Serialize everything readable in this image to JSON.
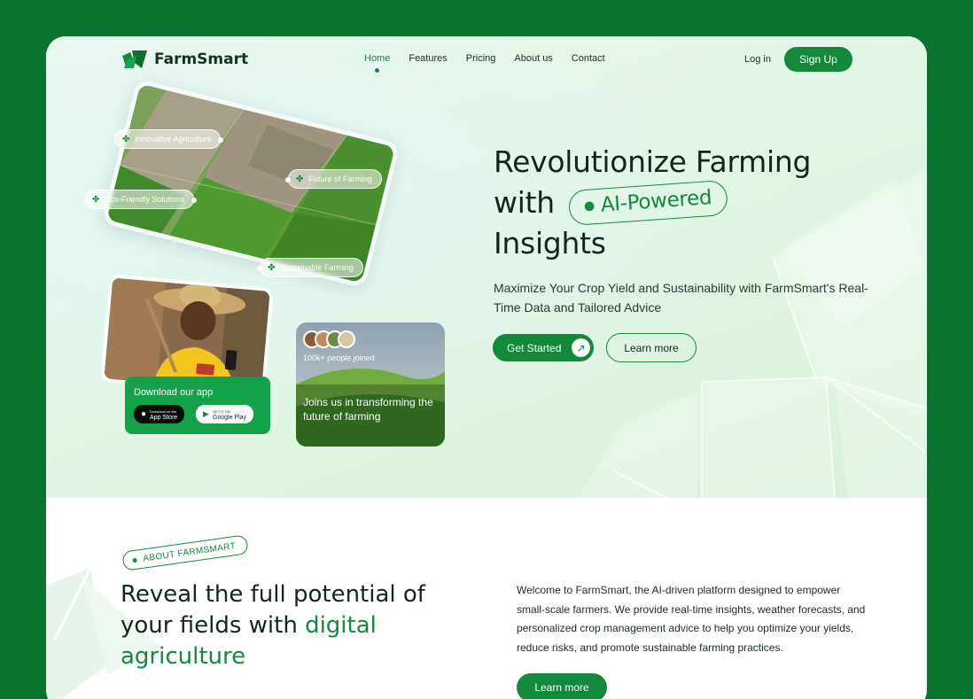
{
  "brand": {
    "name": "FarmSmart",
    "color": "#128a3a",
    "outer_bg": "#0b7331"
  },
  "nav": {
    "items": [
      {
        "label": "Home",
        "active": true
      },
      {
        "label": "Features",
        "active": false
      },
      {
        "label": "Pricing",
        "active": false
      },
      {
        "label": "About us",
        "active": false
      },
      {
        "label": "Contact",
        "active": false
      }
    ],
    "login_label": "Log in",
    "signup_label": "Sign Up"
  },
  "hero": {
    "title_line1": "Revolutionize Farming",
    "title_line2_prefix": "with",
    "title_highlight": "AI-Powered",
    "title_line3": "Insights",
    "subtitle": "Maximize Your Crop Yield and Sustainability with FarmSmart's Real-Time Data and Tailored Advice",
    "cta_primary": "Get Started",
    "cta_secondary": "Learn more",
    "image_tags": [
      "Innovative Agriculture",
      "Future of Farming",
      "Eco-Friendly Solutions",
      "Sustainable Farming"
    ],
    "download": {
      "title": "Download our app",
      "app_store_small": "Download on the",
      "app_store": "App Store",
      "google_play_small": "GET IT ON",
      "google_play": "Google Play"
    },
    "community": {
      "count": "100k+ people joined",
      "message": "Joins us in transforming the future of farming"
    }
  },
  "about": {
    "tag": "ABOUT FARMSMART",
    "heading_plain": "Reveal the full potential of your fields with",
    "heading_highlight": "digital agriculture",
    "body": "Welcome to FarmSmart, the AI-driven platform designed to empower small-scale farmers. We provide real-time insights, weather forecasts, and personalized crop management advice to help you optimize your yields, reduce risks, and promote sustainable farming practices.",
    "cta": "Learn more"
  }
}
